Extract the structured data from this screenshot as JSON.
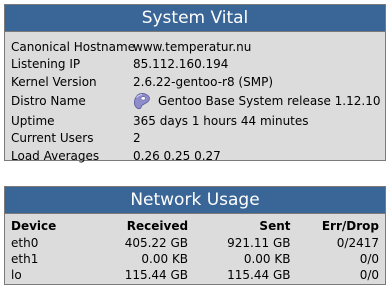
{
  "colors": {
    "header_bg": "#3a6697",
    "panel_bg": "#dcdcdc",
    "border": "#7a7a7a"
  },
  "system_vital": {
    "title": "System Vital",
    "rows": [
      {
        "label": "Canonical Hostname",
        "value": "www.temperatur.nu"
      },
      {
        "label": "Listening IP",
        "value": "85.112.160.194"
      },
      {
        "label": "Kernel Version",
        "value": "2.6.22-gentoo-r8 (SMP)"
      },
      {
        "label": "Distro Name",
        "value": "Gentoo Base System release 1.12.10",
        "icon": "gentoo-logo-icon"
      },
      {
        "label": "Uptime",
        "value": "365 days 1 hours 44 minutes"
      },
      {
        "label": "Current Users",
        "value": "2"
      },
      {
        "label": "Load Averages",
        "value": "0.26 0.25 0.27"
      }
    ]
  },
  "network_usage": {
    "title": "Network Usage",
    "columns": [
      "Device",
      "Received",
      "Sent",
      "Err/Drop"
    ],
    "rows": [
      {
        "device": "eth0",
        "received": "405.22 GB",
        "sent": "921.11 GB",
        "errdrop": "0/2417"
      },
      {
        "device": "eth1",
        "received": "0.00 KB",
        "sent": "0.00 KB",
        "errdrop": "0/0"
      },
      {
        "device": "lo",
        "received": "115.44 GB",
        "sent": "115.44 GB",
        "errdrop": "0/0"
      }
    ]
  }
}
